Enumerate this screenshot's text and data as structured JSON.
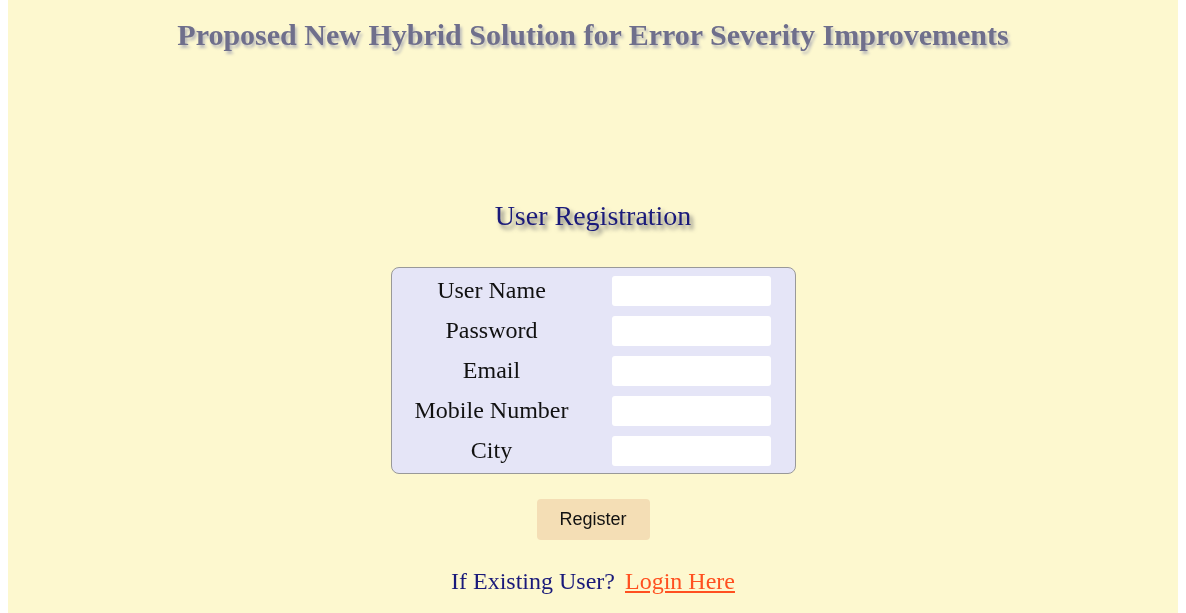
{
  "page_title": "Proposed New Hybrid Solution for Error Severity Improvements",
  "form_title": "User Registration",
  "fields": [
    {
      "label": "User Name"
    },
    {
      "label": "Password"
    },
    {
      "label": "Email"
    },
    {
      "label": "Mobile Number"
    },
    {
      "label": "City"
    }
  ],
  "submit_button": "Register",
  "login_prompt": {
    "text": "If Existing User?",
    "link": "Login Here"
  }
}
